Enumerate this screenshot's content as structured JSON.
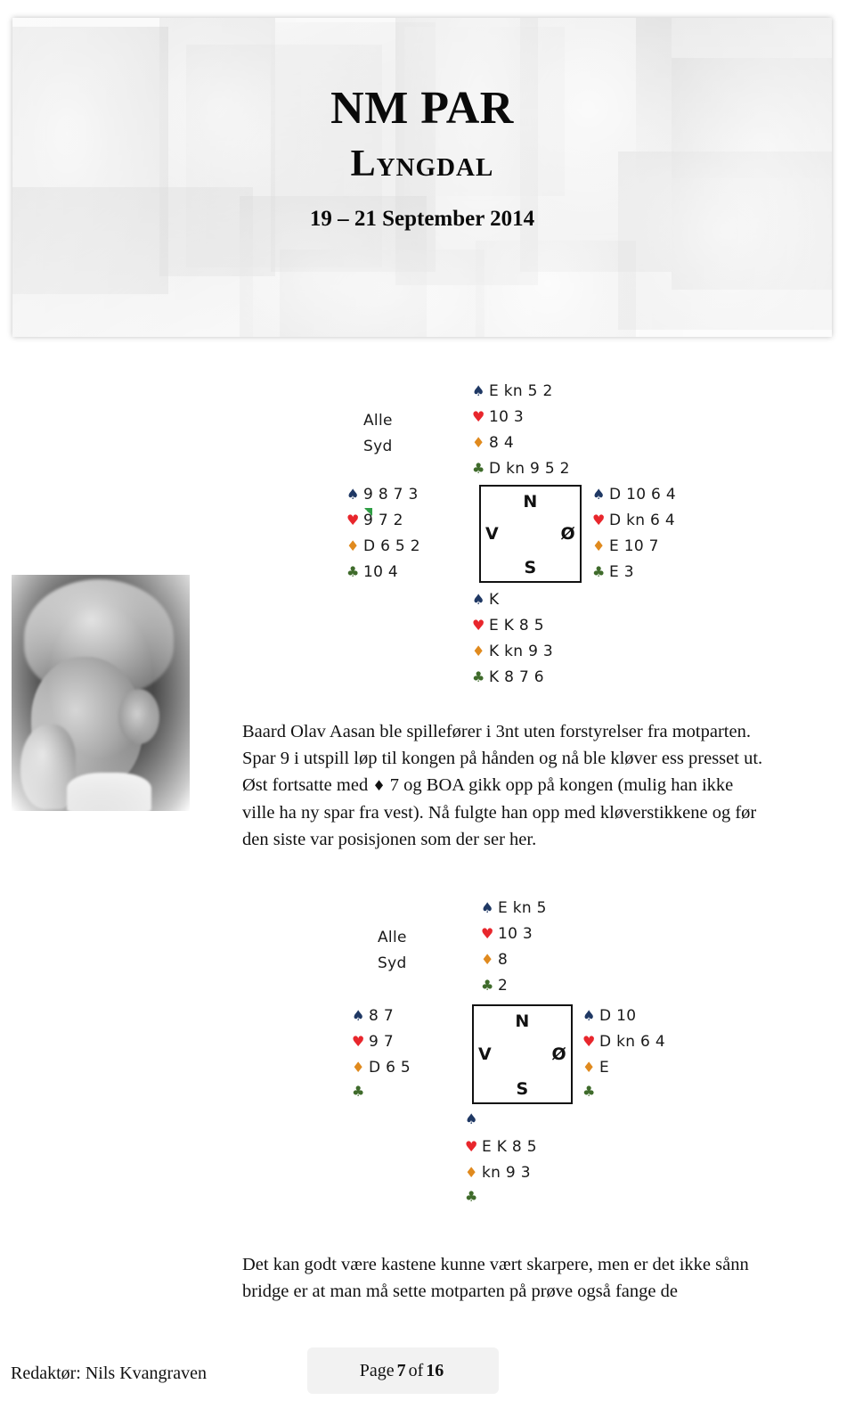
{
  "header": {
    "title_main": "NM PAR",
    "title_sub": "Lyngdal",
    "date": "19 – 21 September 2014",
    "collage_alt": "faded grayscale photo collage of bridge players"
  },
  "deal1": {
    "vulnerability": "Alle",
    "dealer": "Syd",
    "compass": {
      "north": "N",
      "west": "V",
      "east": "Ø",
      "south": "S"
    },
    "north": {
      "spades": "E kn 5 2",
      "hearts": "10 3",
      "diamonds": "8 4",
      "clubs": "D kn 9 5 2"
    },
    "west": {
      "spades": "9 8 7 3",
      "hearts": "9 7 2",
      "diamonds": "D 6 5 2",
      "clubs": "10 4"
    },
    "east": {
      "spades": "D 10 6 4",
      "hearts": "D kn 6 4",
      "diamonds": "E 10 7",
      "clubs": "E 3"
    },
    "south": {
      "spades": "K",
      "hearts": "E K 8 5",
      "diamonds": "K kn 9 3",
      "clubs": "K 8 7 6"
    }
  },
  "deal2": {
    "vulnerability": "Alle",
    "dealer": "Syd",
    "compass": {
      "north": "N",
      "west": "V",
      "east": "Ø",
      "south": "S"
    },
    "north": {
      "spades": "E kn 5",
      "hearts": "10 3",
      "diamonds": "8",
      "clubs": "2"
    },
    "west": {
      "spades": "8 7",
      "hearts": "9 7",
      "diamonds": "D 6 5",
      "clubs": ""
    },
    "east": {
      "spades": "D 10",
      "hearts": "D kn 6 4",
      "diamonds": "E",
      "clubs": ""
    },
    "south": {
      "spades": "",
      "hearts": "E K 8 5",
      "diamonds": "kn 9 3",
      "clubs": ""
    }
  },
  "body": {
    "paragraph1_a": "Baard Olav Aasan ble spillefører i 3nt uten forstyrelser fra motparten. Spar 9 i utspill løp til kongen på hånden og nå ble kløver ess presset ut. Øst fortsatte med ",
    "paragraph1_diamond": "♦",
    "paragraph1_b": " 7 og BOA gikk opp på kongen (mulig han ikke ville ha ny spar fra vest). Nå fulgte han opp med kløverstikkene og før den siste var posisjonen som der ser her.",
    "paragraph2": "Det kan godt være kastene kunne vært skarpere, men er det ikke sånn bridge er at man må sette motparten på prøve også fange de"
  },
  "footer": {
    "editor": "Redaktør: Nils Kvangraven",
    "page_prefix": "Page",
    "page_current": "7",
    "page_middle": "of",
    "page_total": "16"
  },
  "colors": {
    "spade": "#1F3864",
    "heart": "#E8262C",
    "diamond": "#E08A1E",
    "club": "#3F6B2B",
    "footer_box": "#f2f2f2"
  },
  "pips": {
    "spade": "♠",
    "heart": "♥",
    "diamond": "♦",
    "club": "♣"
  }
}
